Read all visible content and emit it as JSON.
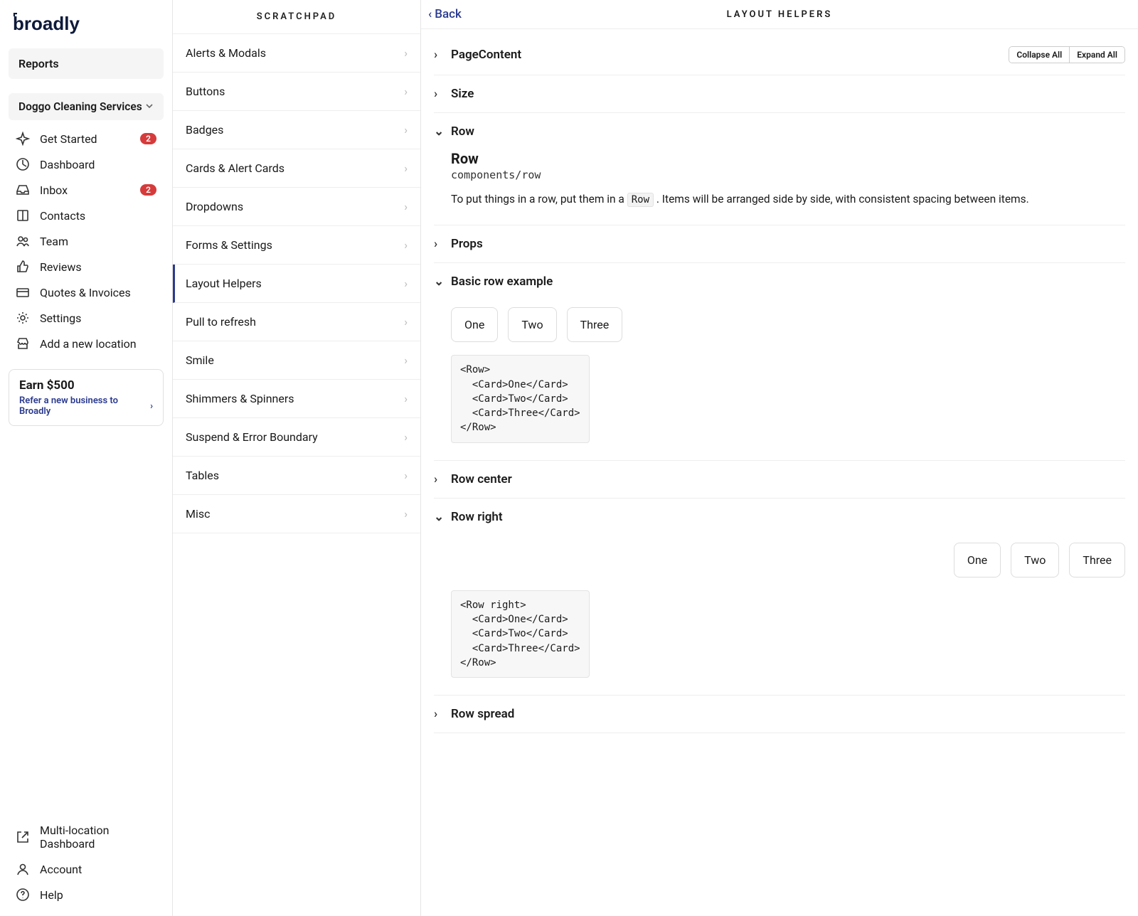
{
  "logo_text": "broadly",
  "reports_label": "Reports",
  "org_name": "Doggo Cleaning Services",
  "nav": [
    {
      "icon": "sparkle",
      "label": "Get Started",
      "badge": "2"
    },
    {
      "icon": "dashboard",
      "label": "Dashboard"
    },
    {
      "icon": "inbox",
      "label": "Inbox",
      "badge": "2"
    },
    {
      "icon": "contacts",
      "label": "Contacts"
    },
    {
      "icon": "team",
      "label": "Team"
    },
    {
      "icon": "reviews",
      "label": "Reviews"
    },
    {
      "icon": "invoices",
      "label": "Quotes & Invoices"
    },
    {
      "icon": "settings",
      "label": "Settings"
    },
    {
      "icon": "addlocation",
      "label": "Add a new location"
    }
  ],
  "earn": {
    "title": "Earn $500",
    "subtitle": "Refer a new business to Broadly"
  },
  "bottom_nav": [
    {
      "icon": "multi",
      "label": "Multi-location Dashboard"
    },
    {
      "icon": "account",
      "label": "Account"
    },
    {
      "icon": "help",
      "label": "Help"
    }
  ],
  "scratchpad": {
    "title": "SCRATCHPAD",
    "items": [
      "Alerts & Modals",
      "Buttons",
      "Badges",
      "Cards & Alert Cards",
      "Dropdowns",
      "Forms & Settings",
      "Layout Helpers",
      "Pull to refresh",
      "Smile",
      "Shimmers & Spinners",
      "Suspend & Error Boundary",
      "Tables",
      "Misc"
    ],
    "active_index": 6
  },
  "detail": {
    "back": "Back",
    "title": "LAYOUT HELPERS",
    "collapse": "Collapse All",
    "expand": "Expand All",
    "sections": {
      "pagecontent": "PageContent",
      "size": "Size",
      "row": "Row",
      "props": "Props",
      "basic_row": "Basic row example",
      "row_center": "Row center",
      "row_right": "Row right",
      "row_spread": "Row spread"
    },
    "row_doc": {
      "heading": "Row",
      "path": "components/row",
      "desc_pre": "To put things in a row, put them in a ",
      "desc_code": "Row",
      "desc_post": ". Items will be arranged side by side, with consistent spacing between items."
    },
    "cards": {
      "one": "One",
      "two": "Two",
      "three": "Three"
    },
    "code1": "<Row>\n  <Card>One</Card>\n  <Card>Two</Card>\n  <Card>Three</Card>\n</Row>",
    "code2": "<Row right>\n  <Card>One</Card>\n  <Card>Two</Card>\n  <Card>Three</Card>\n</Row>"
  }
}
